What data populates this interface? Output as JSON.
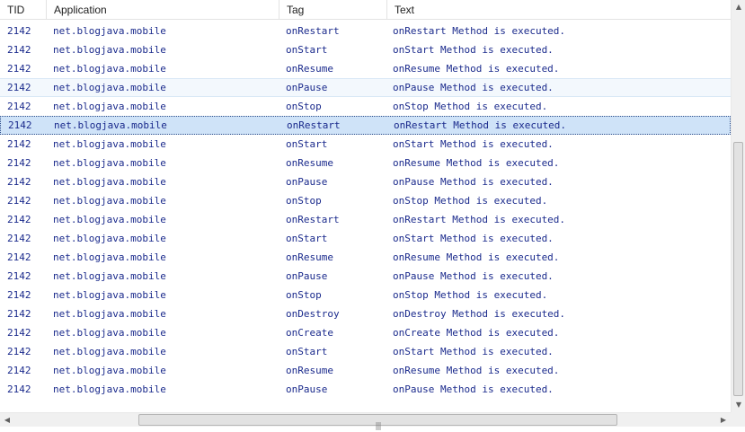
{
  "columns": {
    "tid": "TID",
    "application": "Application",
    "tag": "Tag",
    "text": "Text"
  },
  "rows": [
    {
      "tid": "2142",
      "app": "net.blogjava.mobile",
      "tag": "onRestart",
      "text": "onRestart Method is executed."
    },
    {
      "tid": "2142",
      "app": "net.blogjava.mobile",
      "tag": "onStart",
      "text": "onStart Method is executed."
    },
    {
      "tid": "2142",
      "app": "net.blogjava.mobile",
      "tag": "onResume",
      "text": "onResume Method is executed."
    },
    {
      "tid": "2142",
      "app": "net.blogjava.mobile",
      "tag": "onPause",
      "text": "onPause Method is executed.",
      "state": "hover"
    },
    {
      "tid": "2142",
      "app": "net.blogjava.mobile",
      "tag": "onStop",
      "text": "onStop Method is executed."
    },
    {
      "tid": "2142",
      "app": "net.blogjava.mobile",
      "tag": "onRestart",
      "text": "onRestart Method is executed.",
      "state": "selected"
    },
    {
      "tid": "2142",
      "app": "net.blogjava.mobile",
      "tag": "onStart",
      "text": "onStart Method is executed."
    },
    {
      "tid": "2142",
      "app": "net.blogjava.mobile",
      "tag": "onResume",
      "text": "onResume Method is executed."
    },
    {
      "tid": "2142",
      "app": "net.blogjava.mobile",
      "tag": "onPause",
      "text": "onPause Method is executed."
    },
    {
      "tid": "2142",
      "app": "net.blogjava.mobile",
      "tag": "onStop",
      "text": "onStop Method is executed."
    },
    {
      "tid": "2142",
      "app": "net.blogjava.mobile",
      "tag": "onRestart",
      "text": "onRestart Method is executed."
    },
    {
      "tid": "2142",
      "app": "net.blogjava.mobile",
      "tag": "onStart",
      "text": "onStart Method is executed."
    },
    {
      "tid": "2142",
      "app": "net.blogjava.mobile",
      "tag": "onResume",
      "text": "onResume Method is executed."
    },
    {
      "tid": "2142",
      "app": "net.blogjava.mobile",
      "tag": "onPause",
      "text": "onPause Method is executed."
    },
    {
      "tid": "2142",
      "app": "net.blogjava.mobile",
      "tag": "onStop",
      "text": "onStop Method is executed."
    },
    {
      "tid": "2142",
      "app": "net.blogjava.mobile",
      "tag": "onDestroy",
      "text": "onDestroy Method is executed."
    },
    {
      "tid": "2142",
      "app": "net.blogjava.mobile",
      "tag": "onCreate",
      "text": "onCreate Method is executed."
    },
    {
      "tid": "2142",
      "app": "net.blogjava.mobile",
      "tag": "onStart",
      "text": "onStart Method is executed."
    },
    {
      "tid": "2142",
      "app": "net.blogjava.mobile",
      "tag": "onResume",
      "text": "onResume Method is executed."
    },
    {
      "tid": "2142",
      "app": "net.blogjava.mobile",
      "tag": "onPause",
      "text": "onPause Method is executed."
    }
  ],
  "icons": {
    "scroll_up": "▲",
    "scroll_down": "▼",
    "scroll_left": "◀",
    "scroll_right": "▶",
    "grip": "|||"
  },
  "colors": {
    "text": "#1a2a8c",
    "selected_bg": "#cfe3f8",
    "hover_bg": "#f3f8fd"
  }
}
